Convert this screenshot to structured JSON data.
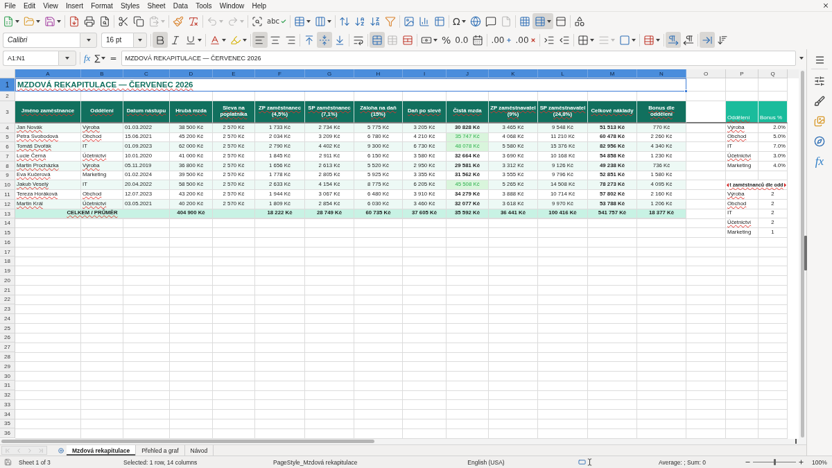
{
  "menu": [
    "File",
    "Edit",
    "View",
    "Insert",
    "Format",
    "Styles",
    "Sheet",
    "Data",
    "Tools",
    "Window",
    "Help"
  ],
  "standard_toolbar": [
    [
      {
        "pressed": false,
        "disabled": false
      },
      {
        "pressed": false,
        "disabled": false
      },
      {
        "pressed": false,
        "disabled": false
      }
    ],
    [
      {
        "pressed": false,
        "disabled": false
      },
      {
        "pressed": false,
        "disabled": false
      },
      {
        "pressed": false,
        "disabled": false
      }
    ],
    [
      {
        "pressed": false,
        "disabled": false
      },
      {
        "pressed": false,
        "disabled": false
      },
      {
        "pressed": false,
        "disabled": true
      }
    ],
    [
      {
        "pressed": false,
        "disabled": false
      },
      {
        "pressed": false,
        "disabled": false
      }
    ],
    [
      {
        "pressed": false,
        "disabled": true
      },
      {
        "pressed": false,
        "disabled": true
      }
    ],
    [
      {
        "pressed": false,
        "disabled": false
      },
      {
        "glyph": "abc",
        "pressed": false,
        "disabled": false
      }
    ],
    [
      {
        "pressed": false,
        "disabled": false
      },
      {
        "pressed": false,
        "disabled": false
      }
    ],
    [
      {
        "pressed": false,
        "disabled": false
      },
      {
        "pressed": false,
        "disabled": false
      },
      {
        "pressed": false,
        "disabled": false
      },
      {
        "pressed": false,
        "disabled": false
      }
    ],
    [
      {
        "pressed": false,
        "disabled": false
      },
      {
        "pressed": false,
        "disabled": false
      },
      {
        "pressed": false,
        "disabled": false
      }
    ],
    [
      {
        "glyph": "Ω",
        "pressed": false,
        "disabled": false
      },
      {
        "pressed": false,
        "disabled": false
      },
      {
        "pressed": false,
        "disabled": false
      },
      {
        "pressed": false,
        "disabled": true
      }
    ],
    [
      {
        "pressed": false,
        "disabled": false
      },
      {
        "pressed": true,
        "disabled": false
      },
      {
        "pressed": false,
        "disabled": false
      }
    ],
    [
      {
        "pressed": false,
        "disabled": false
      }
    ]
  ],
  "formatting_toolbar": {
    "font_name": "Calibri",
    "font_substituted": true,
    "font_size": "16 pt",
    "buttons": [
      [
        {
          "pressed": true,
          "disabled": false
        },
        {
          "pressed": false,
          "disabled": false
        },
        {
          "pressed": false,
          "disabled": false
        }
      ],
      [
        {
          "pressed": false,
          "disabled": false
        },
        {
          "pressed": false,
          "disabled": false
        }
      ],
      [
        {
          "pressed": true,
          "disabled": false
        },
        {
          "pressed": false,
          "disabled": false
        },
        {
          "pressed": false,
          "disabled": false
        }
      ],
      [
        {
          "pressed": false,
          "disabled": false
        },
        {
          "pressed": true,
          "disabled": false
        },
        {
          "pressed": false,
          "disabled": false
        }
      ],
      [
        {
          "pressed": false,
          "disabled": false
        }
      ],
      [
        {
          "pressed": true,
          "disabled": false
        },
        {
          "pressed": false,
          "disabled": true
        },
        {
          "pressed": false,
          "disabled": false
        }
      ],
      [
        {
          "pressed": false,
          "disabled": false
        },
        {
          "glyph": "%",
          "pressed": false,
          "disabled": false
        },
        {
          "glyph": "0.0",
          "pressed": false,
          "disabled": false
        },
        {
          "pressed": false,
          "disabled": false
        }
      ],
      [
        {
          "glyph": ".00",
          "pressed": false,
          "disabled": false
        },
        {
          "glyph": ".00",
          "pressed": false,
          "disabled": false
        }
      ],
      [
        {
          "pressed": false,
          "disabled": false
        },
        {
          "pressed": false,
          "disabled": false
        }
      ],
      [
        {
          "pressed": false,
          "disabled": false
        },
        {
          "pressed": false,
          "disabled": true
        },
        {
          "pressed": false,
          "disabled": false
        }
      ],
      [
        {
          "pressed": false,
          "disabled": false
        }
      ],
      [
        {
          "pressed": true,
          "disabled": false
        },
        {
          "pressed": false,
          "disabled": false
        }
      ],
      [
        {
          "pressed": true,
          "disabled": false
        },
        {
          "pressed": false,
          "disabled": false
        }
      ]
    ]
  },
  "formula_bar": {
    "name_box": "A1:N1",
    "function_wizard": "fx",
    "sum": "∑",
    "equals": "=",
    "content": "MZDOVÁ REKAPITULACE — ČERVENEC 2026"
  },
  "sheet": {
    "columns": [
      {
        "label": "A",
        "selected": true
      },
      {
        "label": "B",
        "selected": true
      },
      {
        "label": "C",
        "selected": true
      },
      {
        "label": "D",
        "selected": true
      },
      {
        "label": "E",
        "selected": true
      },
      {
        "label": "F",
        "selected": true
      },
      {
        "label": "G",
        "selected": true
      },
      {
        "label": "H",
        "selected": true
      },
      {
        "label": "I",
        "selected": true
      },
      {
        "label": "J",
        "selected": true
      },
      {
        "label": "K",
        "selected": true
      },
      {
        "label": "L",
        "selected": true
      },
      {
        "label": "M",
        "selected": true
      },
      {
        "label": "N",
        "selected": true
      },
      {
        "label": "O",
        "selected": false
      },
      {
        "label": "P",
        "selected": false
      },
      {
        "label": "Q",
        "selected": false
      }
    ],
    "rows": [
      {
        "label": "1",
        "selected": true
      },
      {
        "label": "2",
        "selected": false
      },
      {
        "label": "3",
        "selected": false
      },
      {
        "label": "4",
        "selected": false
      },
      {
        "label": "5",
        "selected": false
      },
      {
        "label": "6",
        "selected": false
      },
      {
        "label": "7",
        "selected": false
      },
      {
        "label": "8",
        "selected": false
      },
      {
        "label": "9",
        "selected": false
      },
      {
        "label": "10",
        "selected": false
      },
      {
        "label": "11",
        "selected": false
      },
      {
        "label": "12",
        "selected": false
      },
      {
        "label": "13",
        "selected": false
      },
      {
        "label": "14",
        "selected": false
      },
      {
        "label": "15",
        "selected": false
      },
      {
        "label": "16",
        "selected": false
      },
      {
        "label": "17",
        "selected": false
      },
      {
        "label": "18",
        "selected": false
      },
      {
        "label": "19",
        "selected": false
      },
      {
        "label": "20",
        "selected": false
      },
      {
        "label": "21",
        "selected": false
      },
      {
        "label": "22",
        "selected": false
      },
      {
        "label": "23",
        "selected": false
      },
      {
        "label": "24",
        "selected": false
      },
      {
        "label": "25",
        "selected": false
      },
      {
        "label": "26",
        "selected": false
      },
      {
        "label": "27",
        "selected": false
      },
      {
        "label": "28",
        "selected": false
      },
      {
        "label": "29",
        "selected": false
      },
      {
        "label": "30",
        "selected": false
      },
      {
        "label": "31",
        "selected": false
      },
      {
        "label": "32",
        "selected": false
      },
      {
        "label": "33",
        "selected": false
      },
      {
        "label": "34",
        "selected": false
      },
      {
        "label": "35",
        "selected": false
      },
      {
        "label": "36",
        "selected": false
      }
    ],
    "title": {
      "text": "MZDOVÁ REKAPITULACE — ČERVENEC 2026",
      "misspelled": true,
      "selected": true
    },
    "headers": [
      {
        "label": "Jméno zaměstnance",
        "misspelled": true
      },
      {
        "label": "Oddělení",
        "misspelled": true
      },
      {
        "label": "Datum nástupu",
        "misspelled": true
      },
      {
        "label": "Hrubá mzda",
        "misspelled": true
      },
      {
        "label": "Sleva na poplatníka",
        "misspelled": true
      },
      {
        "label": "ZP zaměstnanec (4,5%)",
        "misspelled": true
      },
      {
        "label": "SP zaměstnanec (7,1%)",
        "misspelled": true
      },
      {
        "label": "Záloha na daň (15%)",
        "misspelled": true
      },
      {
        "label": "Daň po slevě",
        "misspelled": true
      },
      {
        "label": "Čistá mzda",
        "misspelled": true
      },
      {
        "label": "ZP zaměstnavatel (9%)",
        "misspelled": true
      },
      {
        "label": "SP zaměstnavatel (24,8%)",
        "misspelled": true
      },
      {
        "label": "Celkové náklady",
        "misspelled": true
      },
      {
        "label": "Bonus dle oddělení",
        "misspelled": true
      }
    ],
    "employees": [
      {
        "name": "Jan Novák",
        "name_misspelled": true,
        "department": "Výroba",
        "department_misspelled": true,
        "start_date": "01.03.2022",
        "values": [
          "38 500 Kč",
          "2 570 Kč",
          "1 733 Kč",
          "2 734 Kč",
          "5 775 Kč",
          "3 205 Kč",
          "30 828 Kč",
          "3 465 Kč",
          "9 548 Kč",
          "51 513 Kč",
          "770 Kč"
        ],
        "net_pay_highlighted": false
      },
      {
        "name": "Petra Svobodová",
        "name_misspelled": true,
        "department": "Obchod",
        "department_misspelled": true,
        "start_date": "15.06.2021",
        "values": [
          "45 200 Kč",
          "2 570 Kč",
          "2 034 Kč",
          "3 209 Kč",
          "6 780 Kč",
          "4 210 Kč",
          "35 747 Kč",
          "4 068 Kč",
          "11 210 Kč",
          "60 478 Kč",
          "2 260 Kč"
        ],
        "net_pay_highlighted": true
      },
      {
        "name": "Tomáš Dvořák",
        "name_misspelled": true,
        "department": "IT",
        "department_misspelled": false,
        "start_date": "01.09.2023",
        "values": [
          "62 000 Kč",
          "2 570 Kč",
          "2 790 Kč",
          "4 402 Kč",
          "9 300 Kč",
          "6 730 Kč",
          "48 078 Kč",
          "5 580 Kč",
          "15 376 Kč",
          "82 956 Kč",
          "4 340 Kč"
        ],
        "net_pay_highlighted": true
      },
      {
        "name": "Lucie Černá",
        "name_misspelled": true,
        "department": "Účetnictví",
        "department_misspelled": true,
        "start_date": "10.01.2020",
        "values": [
          "41 000 Kč",
          "2 570 Kč",
          "1 845 Kč",
          "2 911 Kč",
          "6 150 Kč",
          "3 580 Kč",
          "32 664 Kč",
          "3 690 Kč",
          "10 168 Kč",
          "54 858 Kč",
          "1 230 Kč"
        ],
        "net_pay_highlighted": false
      },
      {
        "name": "Martin Procházka",
        "name_misspelled": true,
        "department": "Výroba",
        "department_misspelled": true,
        "start_date": "05.11.2019",
        "values": [
          "36 800 Kč",
          "2 570 Kč",
          "1 656 Kč",
          "2 613 Kč",
          "5 520 Kč",
          "2 950 Kč",
          "29 581 Kč",
          "3 312 Kč",
          "9 126 Kč",
          "49 238 Kč",
          "736 Kč"
        ],
        "net_pay_highlighted": false
      },
      {
        "name": "Eva Kučerová",
        "name_misspelled": true,
        "department": "Marketing",
        "department_misspelled": false,
        "start_date": "01.02.2024",
        "values": [
          "39 500 Kč",
          "2 570 Kč",
          "1 778 Kč",
          "2 805 Kč",
          "5 925 Kč",
          "3 355 Kč",
          "31 562 Kč",
          "3 555 Kč",
          "9 796 Kč",
          "52 851 Kč",
          "1 580 Kč"
        ],
        "net_pay_highlighted": false
      },
      {
        "name": "Jakub Veselý",
        "name_misspelled": true,
        "department": "IT",
        "department_misspelled": false,
        "start_date": "20.04.2022",
        "values": [
          "58 500 Kč",
          "2 570 Kč",
          "2 633 Kč",
          "4 154 Kč",
          "8 775 Kč",
          "6 205 Kč",
          "45 508 Kč",
          "5 265 Kč",
          "14 508 Kč",
          "78 273 Kč",
          "4 095 Kč"
        ],
        "net_pay_highlighted": true
      },
      {
        "name": "Tereza Horáková",
        "name_misspelled": true,
        "department": "Obchod",
        "department_misspelled": true,
        "start_date": "12.07.2023",
        "values": [
          "43 200 Kč",
          "2 570 Kč",
          "1 944 Kč",
          "3 067 Kč",
          "6 480 Kč",
          "3 910 Kč",
          "34 279 Kč",
          "3 888 Kč",
          "10 714 Kč",
          "57 802 Kč",
          "2 160 Kč"
        ],
        "net_pay_highlighted": false
      },
      {
        "name": "Martin Král",
        "name_misspelled": true,
        "department": "Účetnictví",
        "department_misspelled": true,
        "start_date": "03.05.2021",
        "values": [
          "40 200 Kč",
          "2 570 Kč",
          "1 809 Kč",
          "2 854 Kč",
          "6 030 Kč",
          "3 460 Kč",
          "32 077 Kč",
          "3 618 Kč",
          "9 970 Kč",
          "53 788 Kč",
          "1 206 Kč"
        ],
        "net_pay_highlighted": false
      }
    ],
    "total": {
      "label": "CELKEM / PRŮMĚR",
      "misspelled": true,
      "gross": "404 900 Kč",
      "values": [
        "18 222 Kč",
        "28 749 Kč",
        "60 735 Kč",
        "37 605 Kč",
        "35 592 Kč",
        "36 441 Kč",
        "100 416 Kč",
        "541 757 Kč",
        "18 377 Kč"
      ]
    },
    "bonus_table": {
      "headers": [
        {
          "label": "Oddělení",
          "misspelled": true
        },
        {
          "label": "Bonus %",
          "misspelled": false
        }
      ],
      "rows": [
        {
          "department": "Výroba",
          "misspelled": true,
          "bonus": "2.0%"
        },
        {
          "department": "Obchod",
          "misspelled": true,
          "bonus": "5.0%"
        },
        {
          "department": "IT",
          "misspelled": false,
          "bonus": "7.0%"
        },
        {
          "department": "Účetnictví",
          "misspelled": true,
          "bonus": "3.0%"
        },
        {
          "department": "Marketing",
          "misspelled": false,
          "bonus": "4.0%"
        }
      ]
    },
    "headcount_table": {
      "title": "t zaměstnanců dle odd",
      "title_misspelled": true,
      "overflow": true,
      "rows": [
        {
          "department": "Výroba",
          "misspelled": true,
          "count": "2"
        },
        {
          "department": "Obchod",
          "misspelled": true,
          "count": "2"
        },
        {
          "department": "IT",
          "misspelled": false,
          "count": "2"
        },
        {
          "department": "Účetnictví",
          "misspelled": true,
          "count": "2"
        },
        {
          "department": "Marketing",
          "misspelled": false,
          "count": "1"
        }
      ]
    }
  },
  "sheet_tabs": [
    {
      "label": "Mzdová rekapitulace",
      "selected": true
    },
    {
      "label": "Přehled a graf",
      "selected": false
    },
    {
      "label": "Návod",
      "selected": false
    }
  ],
  "sidebar": {
    "functions": "fx"
  },
  "status_bar": {
    "sheet": "Sheet 1 of 3",
    "selection": "Selected: 1 row, 14 columns",
    "page_style": "PageStyle_Mzdová rekapitulace",
    "language": "English (USA)",
    "summary": "Average: ; Sum: 0",
    "zoom": {
      "level": 0.5,
      "reading": "100%"
    }
  }
}
